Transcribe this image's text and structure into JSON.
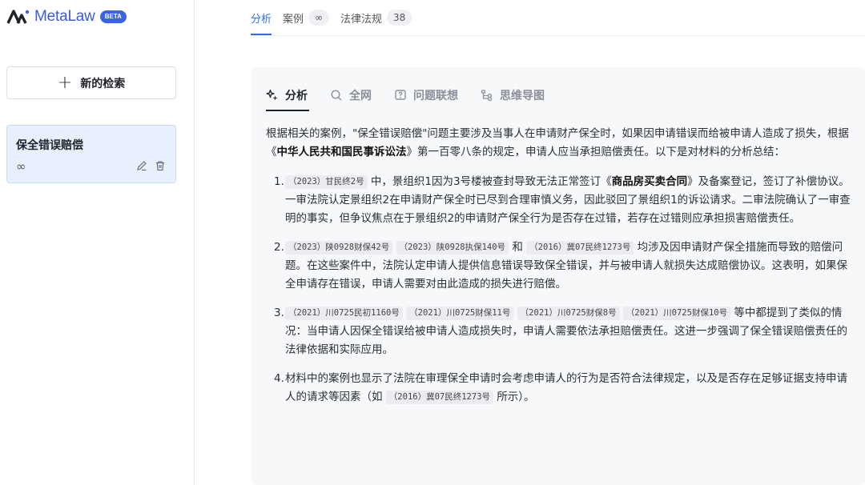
{
  "app": {
    "name": "MetaLaw",
    "badge": "BETA"
  },
  "sidebar": {
    "new_search_label": "新的检索",
    "history": [
      {
        "title": "保全错误赔偿",
        "meta": "∞"
      }
    ]
  },
  "top_tabs": [
    {
      "label": "分析",
      "count": ""
    },
    {
      "label": "案例",
      "count": "∞"
    },
    {
      "label": "法律法规",
      "count": "38"
    }
  ],
  "inner_tabs": [
    {
      "label": "分析",
      "icon": "sparkle-icon"
    },
    {
      "label": "全网",
      "icon": "search-icon"
    },
    {
      "label": "问题联想",
      "icon": "question-icon"
    },
    {
      "label": "思维导图",
      "icon": "mindmap-icon"
    }
  ],
  "content": {
    "intro_1": "根据相关的案例，\"保全错误赔偿\"问题主要涉及当事人在申请财产保全时，如果因申请错误而给被申请人造成了损失，根据《",
    "intro_law": "中华人民共和国民事诉讼法",
    "intro_2": "》第一百零八条的规定，申请人应当承担赔偿责任。以下是对材料的分析总结：",
    "items": [
      {
        "num": "1.",
        "case_1": "（2023）甘民终2号",
        "t1": " 中，景组织1因为3号楼被查封导致无法正常签订《",
        "bold": "商品房买卖合同",
        "t2": "》及备案登记，签订了补偿协议。一审法院认定景组织2在申请财产保全时已尽到合理审慎义务，因此驳回了景组织1的诉讼请求。二审法院确认了一审查明的事实，但争议焦点在于景组织2的申请财产保全行为是否存在过错，若存在过错则应承担损害赔偿责任。"
      },
      {
        "num": "2.",
        "case_1": "（2023）陕0928财保42号",
        "case_2": "（2023）陕0928执保140号",
        "and": " 和 ",
        "case_3": "（2016）冀07民终1273号",
        "t1": " 均涉及因申请财产保全措施而导致的赔偿问题。在这些案件中，法院认定申请人提供信息错误导致保全错误，并与被申请人就损失达成赔偿协议。这表明，如果保全申请存在错误，申请人需要对由此造成的损失进行赔偿。"
      },
      {
        "num": "3.",
        "case_1": "（2021）川0725民初1160号",
        "case_2": "（2021）川0725财保11号",
        "case_3": "（2021）川0725财保8号",
        "case_4": "（2021）川0725财保10号",
        "t1": " 等中都提到了类似的情况：当申请人因保全错误给被申请人造成损失时，申请人需要依法承担赔偿责任。这进一步强调了保全错误赔偿责任的法律依据和实际应用。"
      },
      {
        "num": "4.",
        "t1": "材料中的案例也显示了法院在审理保全申请时会考虑申请人的行为是否符合法律规定，以及是否存在足够证据支持申请人的请求等因素（如 ",
        "case_1": "（2016）冀07民终1273号",
        "t2": " 所示）。"
      }
    ]
  },
  "colors": {
    "accent": "#2f6fe4",
    "brand": "#3b5bdb",
    "selected_bg": "#e8f0fe"
  }
}
